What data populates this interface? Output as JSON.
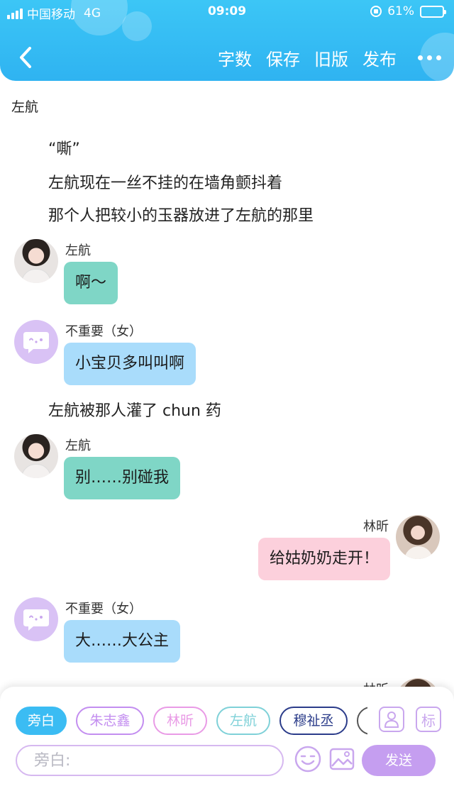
{
  "status_bar": {
    "carrier": "中国移动",
    "network": "4G",
    "time": "09:09",
    "battery": "61%",
    "battery_level": 0.61
  },
  "header": {
    "actions": [
      "字数",
      "保存",
      "旧版",
      "发布"
    ]
  },
  "content": {
    "top_label": "左航",
    "narration_1": "“嘶”",
    "narration_2": "左航现在一丝不挂的在墙角颤抖着",
    "narration_3": "那个人把较小的玉器放进了左航的那里",
    "narration_4": "左航被那人灌了 chun 药",
    "messages": [
      {
        "side": "left",
        "name": "左航",
        "text": "啊～",
        "bubble_color": "#7fd6c6",
        "avatar": "photo"
      },
      {
        "side": "left",
        "name": "不重要（女）",
        "text": "小宝贝多叫叫啊",
        "bubble_color": "#a9dcfb",
        "avatar": "default"
      },
      {
        "side": "left",
        "name": "左航",
        "text": "别……别碰我",
        "bubble_color": "#7fd6c6",
        "avatar": "photo"
      },
      {
        "side": "right",
        "name": "林昕",
        "text": "给姑奶奶走开！",
        "bubble_color": "#fcd0dc",
        "avatar": "photo2"
      },
      {
        "side": "left",
        "name": "不重要（女）",
        "text": "大……大公主",
        "bubble_color": "#a9dcfb",
        "avatar": "default"
      },
      {
        "side": "right",
        "name": "林昕",
        "text": "",
        "avatar": "photo2"
      }
    ]
  },
  "panel": {
    "chips": [
      {
        "label": "旁白",
        "color": "#3bbcf3",
        "active": true
      },
      {
        "label": "朱志鑫",
        "color": "#c38ef0",
        "active": false
      },
      {
        "label": "林昕",
        "color": "#e99be6",
        "active": false
      },
      {
        "label": "左航",
        "color": "#7fd1d8",
        "active": false
      },
      {
        "label": "穆祉丞",
        "color": "#2b3c8a",
        "active": false
      }
    ],
    "tag_icon_label": "标",
    "input_placeholder": "旁白:",
    "send_label": "发送",
    "accent": "#c59ef0"
  }
}
